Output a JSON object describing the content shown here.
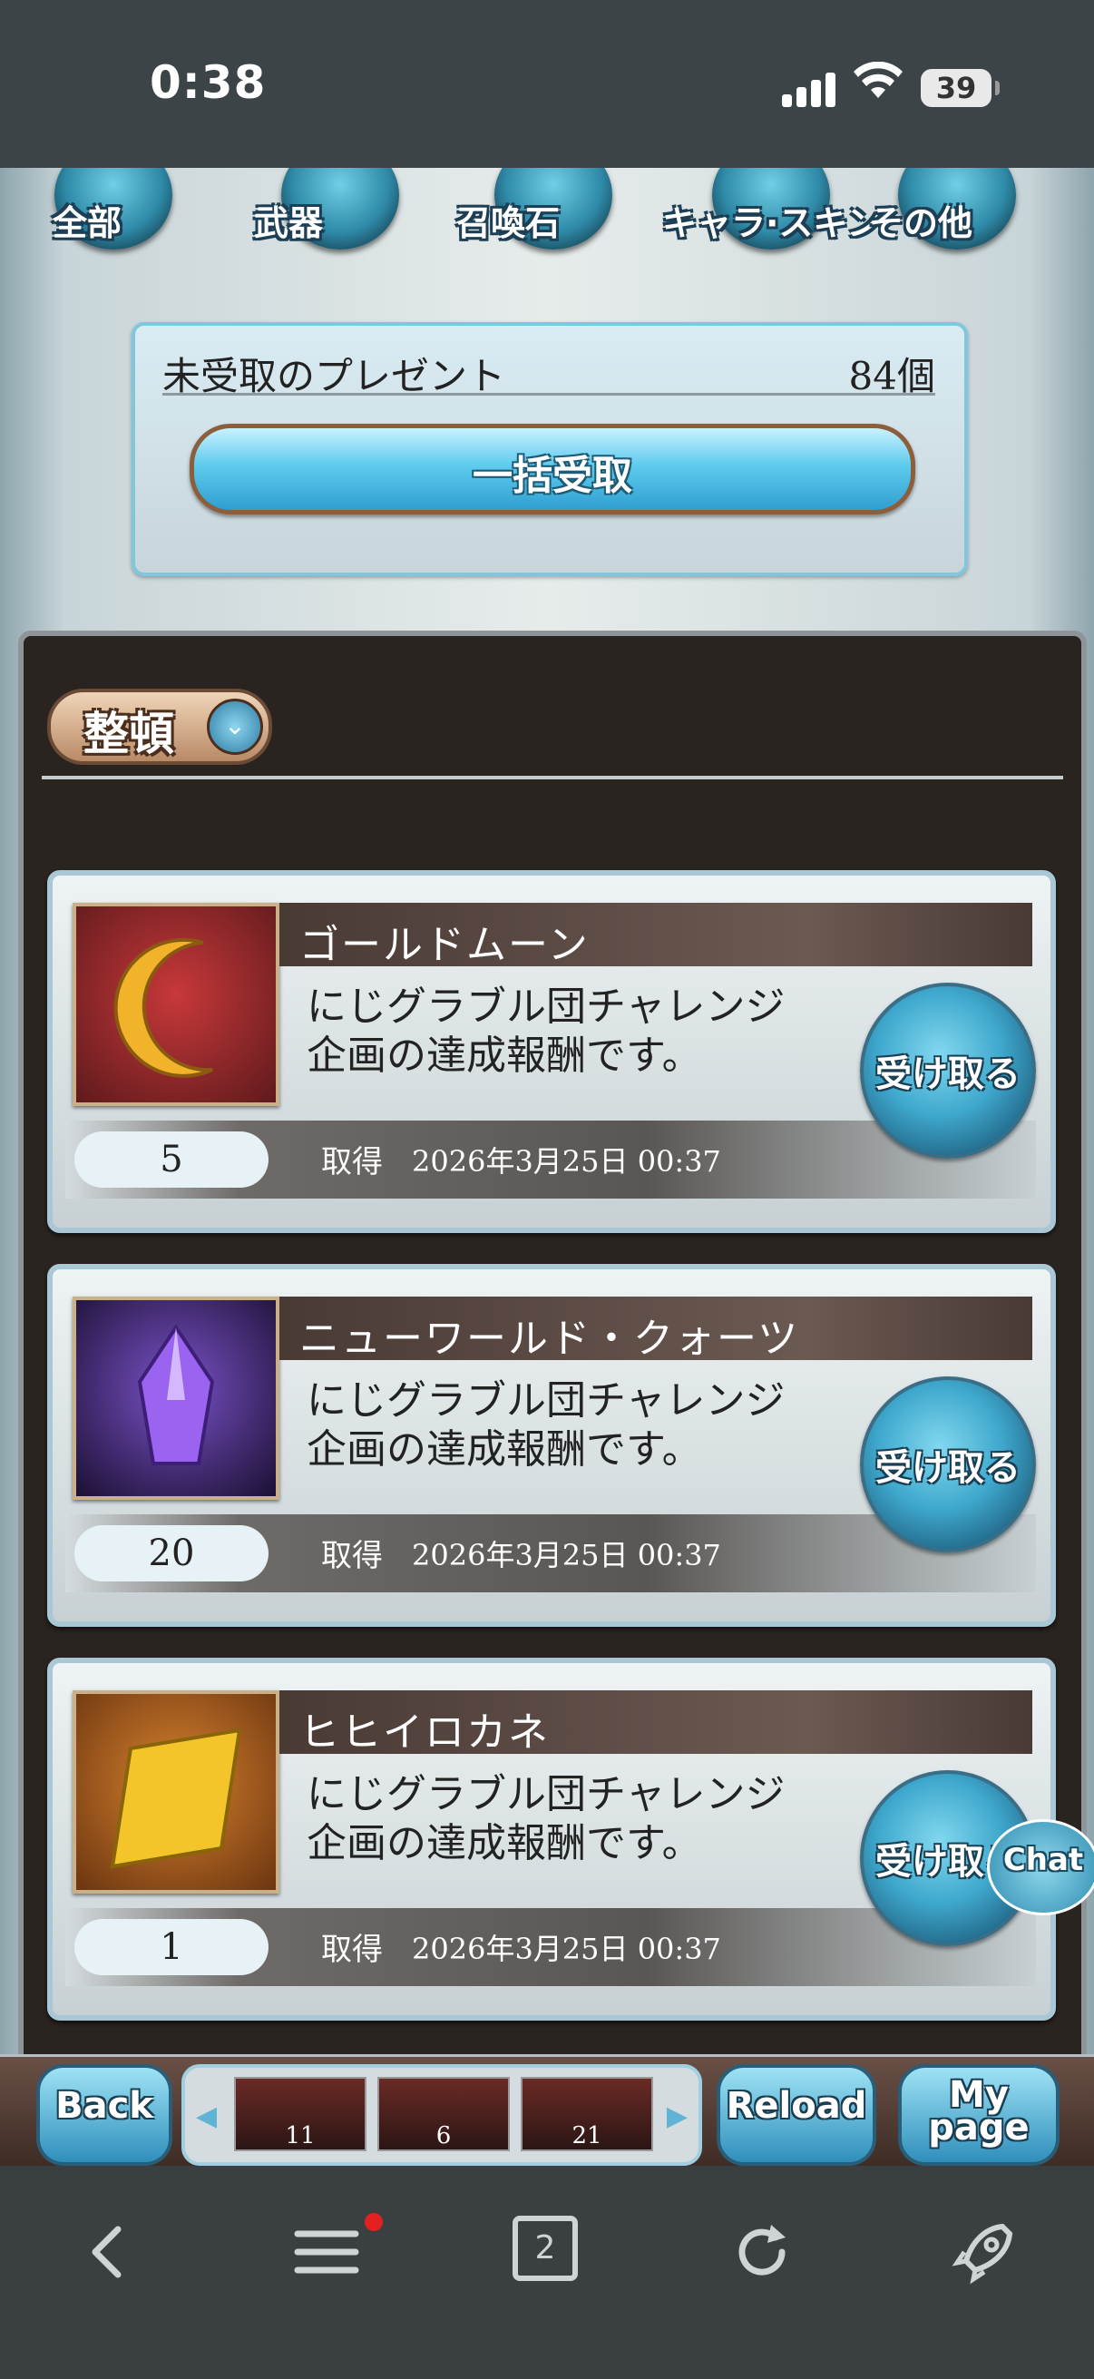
{
  "status_bar": {
    "time": "0:38",
    "battery": "39"
  },
  "categories": [
    "全部",
    "武器",
    "召喚石",
    "キャラ·スキン",
    "その他"
  ],
  "unreceived": {
    "title": "未受取のプレゼント",
    "count": "84個",
    "bulk_button": "一括受取"
  },
  "sort_button": "整頓",
  "presents": [
    {
      "name": "ゴールドムーン",
      "description": "にじグラブル団チャレンジ\n企画の達成報酬です。",
      "quantity": "5",
      "acquired_label": "取得",
      "date": "2026年3月25日 00:37",
      "receive_button": "受け取る"
    },
    {
      "name": "ニューワールド・クォーツ",
      "description": "にじグラブル団チャレンジ\n企画の達成報酬です。",
      "quantity": "20",
      "acquired_label": "取得",
      "date": "2026年3月25日 00:37",
      "receive_button": "受け取る"
    },
    {
      "name": "ヒヒイロカネ",
      "description": "にじグラブル団チャレンジ\n企画の達成報酬です。",
      "quantity": "1",
      "acquired_label": "取得",
      "date": "2026年3月25日 00:37",
      "receive_button": "受け取る"
    }
  ],
  "chat_button": "Chat",
  "game_bar": {
    "back": "Back",
    "reload": "Reload",
    "mypage": "My page",
    "items": [
      "11",
      "6",
      "21"
    ]
  },
  "browser_nav": {
    "tabs_count": "2"
  }
}
